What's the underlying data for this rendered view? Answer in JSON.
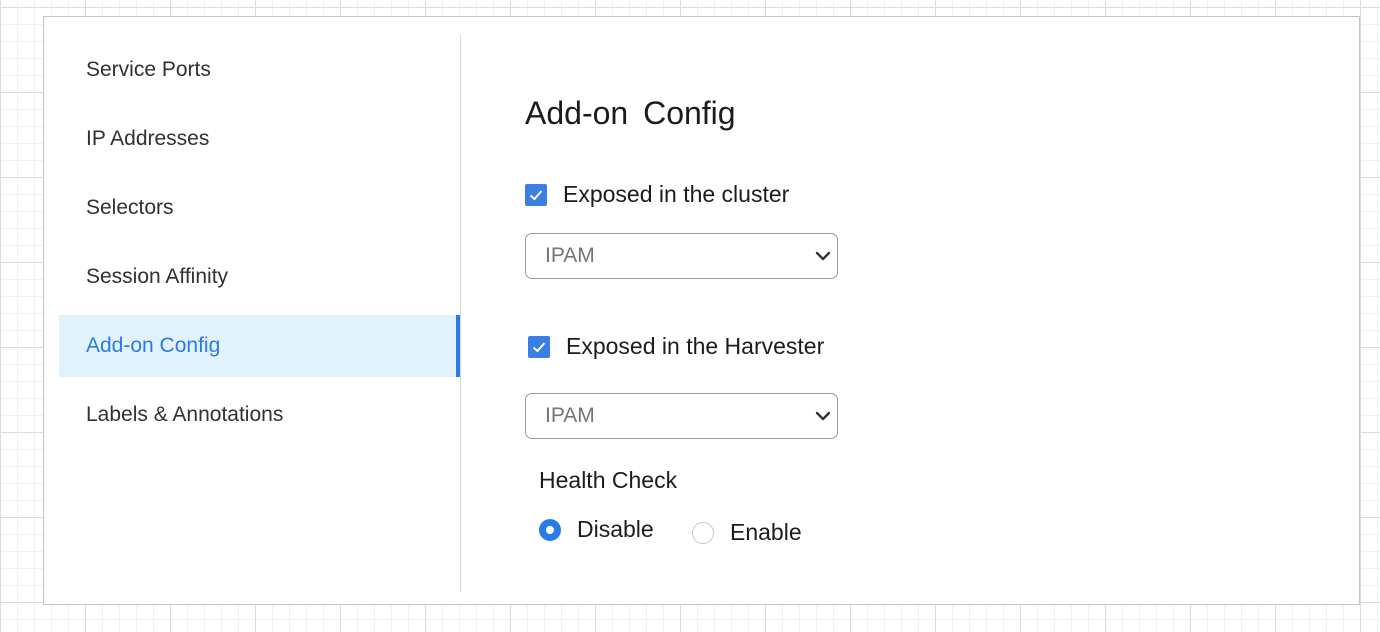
{
  "sidebar": {
    "items": [
      {
        "label": "Service Ports"
      },
      {
        "label": "IP Addresses"
      },
      {
        "label": "Selectors"
      },
      {
        "label": "Session Affinity"
      },
      {
        "label": "Add-on Config",
        "active": true
      },
      {
        "label": "Labels & Annotations"
      }
    ]
  },
  "main": {
    "title": "Add-on Config",
    "cluster": {
      "checkbox_label": "Exposed in the cluster",
      "checked": true,
      "select_value": "IPAM"
    },
    "harvester": {
      "checkbox_label": "Exposed in the Harvester",
      "checked": true,
      "select_value": "IPAM"
    },
    "health_check": {
      "label": "Health Check",
      "options": [
        {
          "label": "Disable",
          "selected": true
        },
        {
          "label": "Enable",
          "selected": false
        }
      ]
    }
  },
  "icons": {
    "checkbox": "checkmark-icon",
    "select": "chevron-down-icon"
  },
  "colors": {
    "accent": "#2a7be4",
    "active_background": "#e1f2fd",
    "text": "#2f3136"
  }
}
